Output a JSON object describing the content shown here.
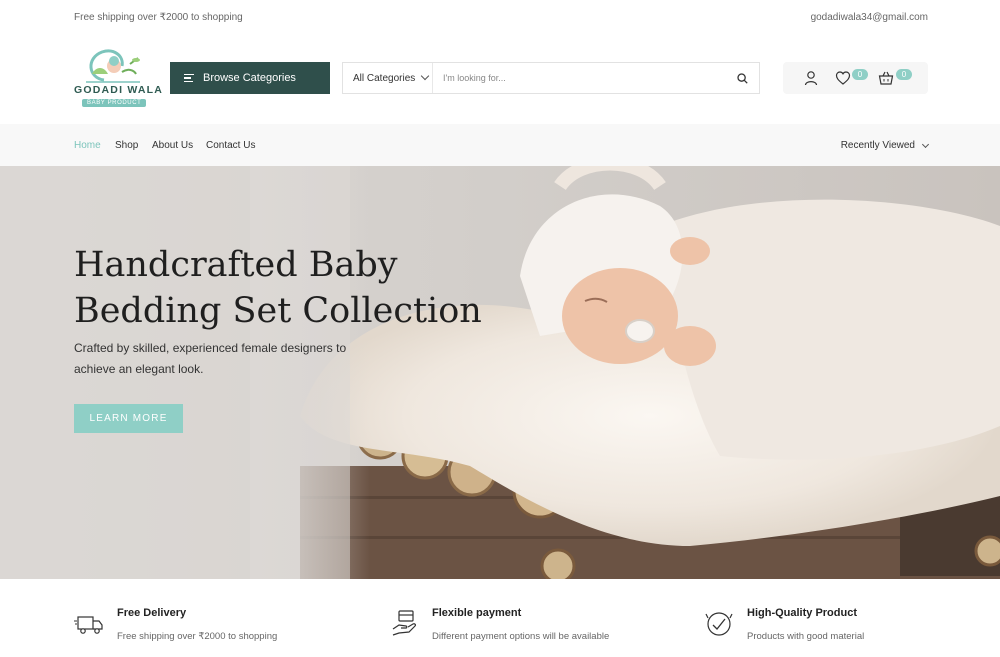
{
  "topbar": {
    "shipping_text": "Free shipping over ₹2000 to shopping",
    "email": "godadiwala34@gmail.com"
  },
  "logo": {
    "name": "GODADI WALA",
    "tagline": "BABY PRODUCT"
  },
  "header": {
    "browse_label": "Browse Categories",
    "search": {
      "category": "All Categories",
      "placeholder": "I'm looking for..."
    },
    "wishlist_count": "0",
    "cart_count": "0"
  },
  "nav": {
    "items": [
      {
        "label": "Home"
      },
      {
        "label": "Shop"
      },
      {
        "label": "About Us"
      },
      {
        "label": "Contact Us"
      }
    ],
    "recently_viewed": "Recently Viewed"
  },
  "hero": {
    "title": "Handcrafted Baby Bedding Set Collection",
    "description": "Crafted by skilled, experienced female designers to achieve an elegant look.",
    "cta": "LEARN MORE"
  },
  "features": [
    {
      "title": "Free Delivery",
      "desc": "Free shipping over ₹2000 to shopping",
      "icon": "truck-icon"
    },
    {
      "title": "Flexible payment",
      "desc": "Different payment options will be available",
      "icon": "payment-icon"
    },
    {
      "title": "High-Quality Product",
      "desc": "Products with good material",
      "icon": "quality-badge-icon"
    }
  ],
  "colors": {
    "accent": "#8fcfc6",
    "dark": "#2f4f4b",
    "active_nav": "#7cc4bb"
  }
}
